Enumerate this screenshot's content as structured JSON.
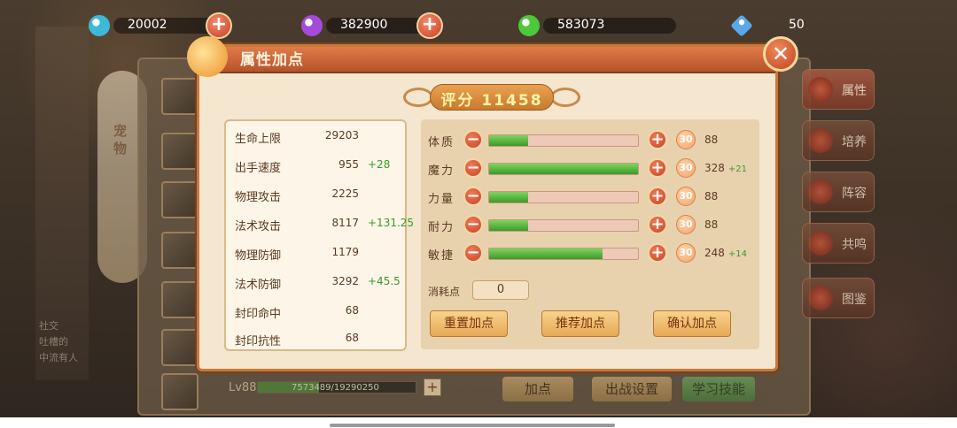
{
  "currencies": [
    {
      "value": "20002",
      "color": "#3cb8d8",
      "icon": "cyan-gem-icon",
      "has_plus": true
    },
    {
      "value": "382900",
      "color": "#a54bd8",
      "icon": "purple-gem-icon",
      "has_plus": true
    },
    {
      "value": "583073",
      "color": "#4ec83a",
      "icon": "green-gem-icon",
      "has_plus": false
    },
    {
      "value": "50",
      "color": "#5aa8e8",
      "icon": "diamond-icon",
      "has_plus": false
    }
  ],
  "dialog": {
    "title": "属性加点",
    "close_icon": "close-icon",
    "score_label": "评分 11458"
  },
  "stats": [
    {
      "name": "生命上限",
      "value": "29203",
      "bonus": ""
    },
    {
      "name": "出手速度",
      "value": "955",
      "bonus": "+28"
    },
    {
      "name": "物理攻击",
      "value": "2225",
      "bonus": ""
    },
    {
      "name": "法术攻击",
      "value": "8117",
      "bonus": "+131.25"
    },
    {
      "name": "物理防御",
      "value": "1179",
      "bonus": ""
    },
    {
      "name": "法术防御",
      "value": "3292",
      "bonus": "+45.5"
    },
    {
      "name": "封印命中",
      "value": "68",
      "bonus": ""
    },
    {
      "name": "封印抗性",
      "value": "68",
      "bonus": ""
    }
  ],
  "attributes": [
    {
      "name": "体质",
      "fill": 0.26,
      "step": "30",
      "value": "88",
      "bonus": ""
    },
    {
      "name": "魔力",
      "fill": 1.0,
      "step": "30",
      "value": "328",
      "bonus": "+21"
    },
    {
      "name": "力量",
      "fill": 0.26,
      "step": "30",
      "value": "88",
      "bonus": ""
    },
    {
      "name": "耐力",
      "fill": 0.26,
      "step": "30",
      "value": "88",
      "bonus": ""
    },
    {
      "name": "敏捷",
      "fill": 0.76,
      "step": "30",
      "value": "248",
      "bonus": "+14"
    }
  ],
  "consumed": {
    "label": "消耗点",
    "value": "0"
  },
  "buttons": {
    "reset": "重置加点",
    "recommend": "推荐加点",
    "confirm": "确认加点"
  },
  "side_menu": [
    "属性",
    "培养",
    "阵容",
    "共鸣",
    "图鉴"
  ],
  "background": {
    "pet_tab": "宠物",
    "level": "Lv88",
    "exp_text": "7573489/19290250",
    "exp_fill": 0.39,
    "bottom_buttons": [
      "加点",
      "出战设置",
      "学习技能"
    ],
    "chat_lines": [
      "社交",
      "吐槽的",
      "中流有人"
    ]
  }
}
